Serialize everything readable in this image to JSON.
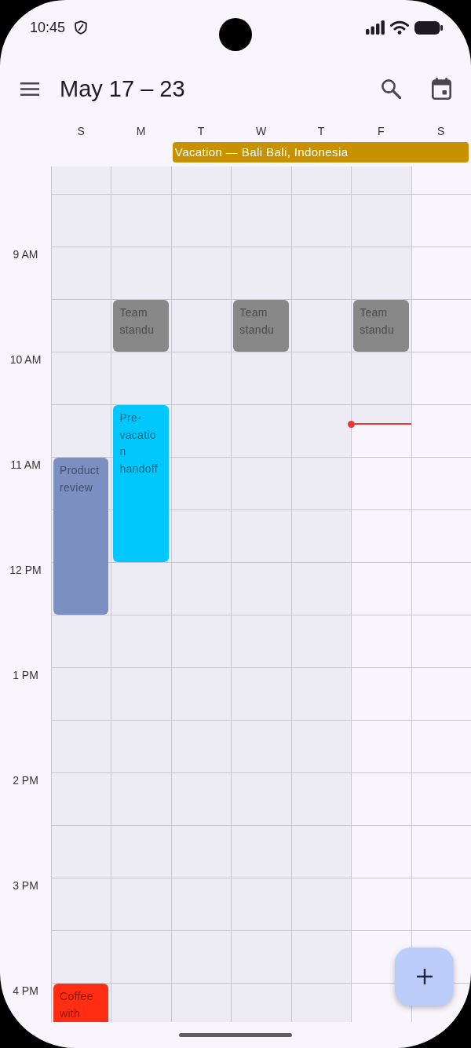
{
  "status_bar": {
    "time": "10:45"
  },
  "app_bar": {
    "title": "May 17 – 23"
  },
  "week": {
    "all_day": [
      {
        "kind": "free"
      },
      {
        "kind": "free"
      },
      {
        "kind": "event",
        "title": "Vacation — Bali Bali, Indonesia",
        "color": "#c79100"
      },
      {
        "kind": "continued"
      },
      {
        "kind": "continued"
      },
      {
        "kind": "continued"
      },
      {
        "kind": "continued"
      }
    ],
    "hours": [
      "9 AM",
      "10 AM",
      "11 AM",
      "12 PM",
      "1 PM",
      "2 PM",
      "3 PM",
      "4 PM"
    ],
    "days": [
      {
        "label": "S",
        "slots": [
          {
            "kind": "free"
          },
          {
            "kind": "free"
          },
          {
            "kind": "free"
          },
          {
            "kind": "free"
          },
          {
            "kind": "free"
          },
          {
            "kind": "free"
          },
          {
            "kind": "event",
            "title": "Product review",
            "color": "#7b8fc1"
          },
          {
            "kind": "continued"
          },
          {
            "kind": "continued"
          },
          {
            "kind": "free"
          },
          {
            "kind": "free"
          },
          {
            "kind": "free"
          },
          {
            "kind": "free"
          },
          {
            "kind": "free"
          },
          {
            "kind": "free"
          },
          {
            "kind": "free"
          },
          {
            "kind": "event",
            "title": "Coffee with",
            "color": "#ff2d12"
          }
        ]
      },
      {
        "label": "M",
        "slots": [
          {
            "kind": "free"
          },
          {
            "kind": "free"
          },
          {
            "kind": "free"
          },
          {
            "kind": "event",
            "title": "Team standu",
            "color": "#888888"
          },
          {
            "kind": "free"
          },
          {
            "kind": "event",
            "title": "Pre-vacation handoff",
            "color": "#00c8fd"
          },
          {
            "kind": "continued"
          },
          {
            "kind": "continued"
          },
          {
            "kind": "free"
          },
          {
            "kind": "free"
          },
          {
            "kind": "free"
          },
          {
            "kind": "free"
          },
          {
            "kind": "free"
          },
          {
            "kind": "free"
          },
          {
            "kind": "free"
          },
          {
            "kind": "free"
          },
          {
            "kind": "free"
          }
        ]
      },
      {
        "label": "T",
        "slots": [
          {
            "kind": "free"
          },
          {
            "kind": "free"
          },
          {
            "kind": "free"
          },
          {
            "kind": "free"
          },
          {
            "kind": "free"
          },
          {
            "kind": "free"
          },
          {
            "kind": "free"
          },
          {
            "kind": "free"
          },
          {
            "kind": "free"
          },
          {
            "kind": "free"
          },
          {
            "kind": "free"
          },
          {
            "kind": "free"
          },
          {
            "kind": "free"
          },
          {
            "kind": "free"
          },
          {
            "kind": "free"
          },
          {
            "kind": "free"
          },
          {
            "kind": "free"
          }
        ]
      },
      {
        "label": "W",
        "slots": [
          {
            "kind": "free"
          },
          {
            "kind": "free"
          },
          {
            "kind": "free"
          },
          {
            "kind": "event",
            "title": "Team standu",
            "color": "#888888"
          },
          {
            "kind": "free"
          },
          {
            "kind": "free"
          },
          {
            "kind": "free"
          },
          {
            "kind": "free"
          },
          {
            "kind": "free"
          },
          {
            "kind": "free"
          },
          {
            "kind": "free"
          },
          {
            "kind": "free"
          },
          {
            "kind": "free"
          },
          {
            "kind": "free"
          },
          {
            "kind": "free"
          },
          {
            "kind": "free"
          },
          {
            "kind": "free"
          }
        ]
      },
      {
        "label": "T",
        "slots": [
          {
            "kind": "free"
          },
          {
            "kind": "free"
          },
          {
            "kind": "free"
          },
          {
            "kind": "free"
          },
          {
            "kind": "free"
          },
          {
            "kind": "free"
          },
          {
            "kind": "free"
          },
          {
            "kind": "free"
          },
          {
            "kind": "free"
          },
          {
            "kind": "free"
          },
          {
            "kind": "free"
          },
          {
            "kind": "free"
          },
          {
            "kind": "free"
          },
          {
            "kind": "free"
          },
          {
            "kind": "free"
          },
          {
            "kind": "free"
          },
          {
            "kind": "free"
          }
        ]
      },
      {
        "label": "F",
        "slots": [
          {
            "kind": "free"
          },
          {
            "kind": "free"
          },
          {
            "kind": "free"
          },
          {
            "kind": "event",
            "title": "Team standu",
            "color": "#888888"
          },
          {
            "kind": "free"
          },
          {
            "kind": "now"
          },
          {
            "kind": "free"
          },
          {
            "kind": "free"
          },
          {
            "kind": "free"
          },
          {
            "kind": "free"
          },
          {
            "kind": "free"
          },
          {
            "kind": "free"
          },
          {
            "kind": "free"
          },
          {
            "kind": "free"
          },
          {
            "kind": "free"
          },
          {
            "kind": "free"
          },
          {
            "kind": "free"
          }
        ]
      },
      {
        "label": "S",
        "slots": [
          {
            "kind": "free"
          },
          {
            "kind": "free"
          },
          {
            "kind": "free"
          },
          {
            "kind": "free"
          },
          {
            "kind": "free"
          },
          {
            "kind": "free"
          },
          {
            "kind": "free"
          },
          {
            "kind": "free"
          },
          {
            "kind": "free"
          },
          {
            "kind": "free"
          },
          {
            "kind": "free"
          },
          {
            "kind": "free"
          },
          {
            "kind": "free"
          },
          {
            "kind": "free"
          },
          {
            "kind": "free"
          },
          {
            "kind": "free"
          },
          {
            "kind": "free"
          }
        ]
      }
    ]
  }
}
